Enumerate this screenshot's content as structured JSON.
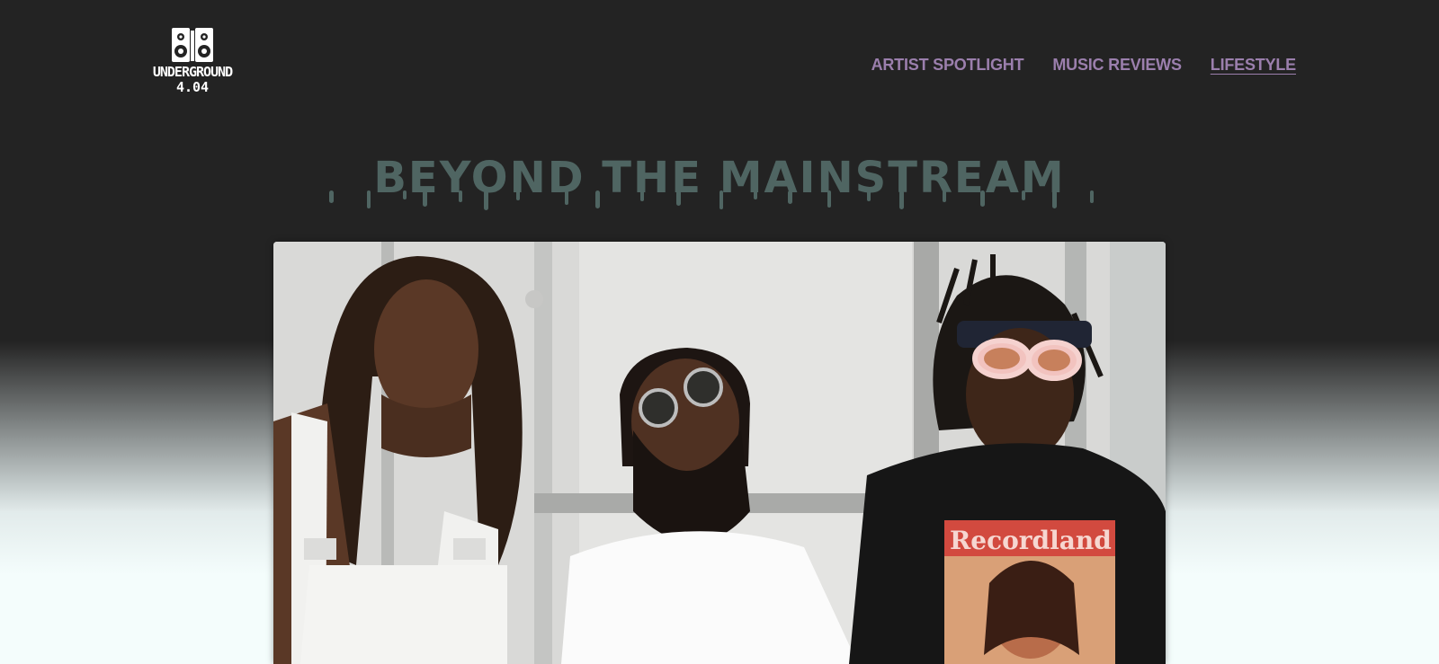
{
  "logo": {
    "line1": "UNDERGROUND",
    "line2": "4.04",
    "icon": "speakers-icon"
  },
  "nav": {
    "items": [
      {
        "label": "ARTIST SPOTLIGHT"
      },
      {
        "label": "MUSIC REVIEWS"
      },
      {
        "label": "LIFESTYLE"
      }
    ],
    "active_index": 2
  },
  "headline": "BEYOND THE MAINSTREAM",
  "hero": {
    "shirt_text": "Recordland"
  },
  "colors": {
    "header_bg": "#232323",
    "nav_link": "#9b7fad",
    "headline": "#4f6562",
    "page_bottom": "#f4fdfc"
  }
}
